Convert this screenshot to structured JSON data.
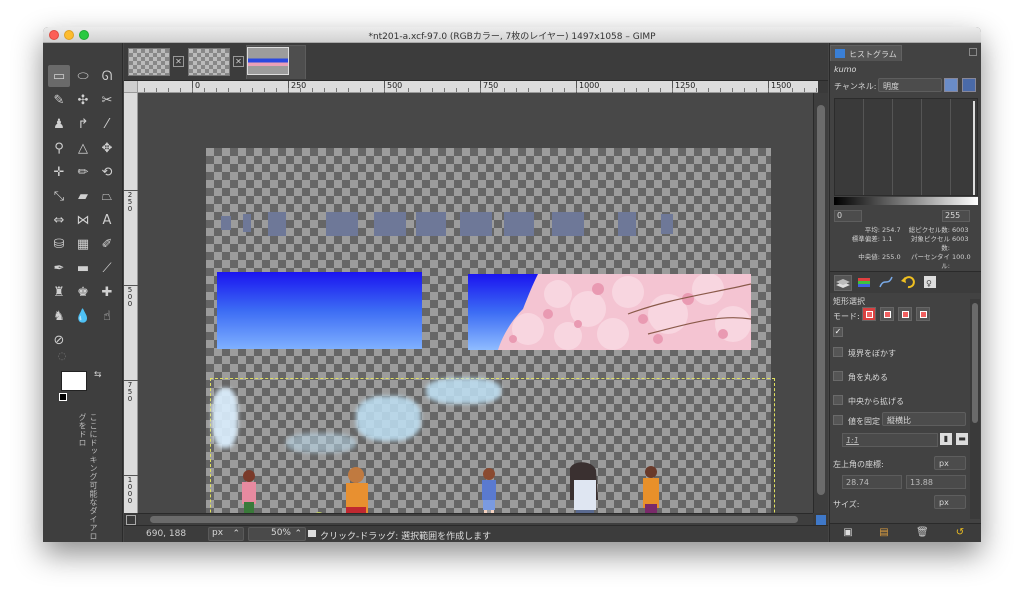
{
  "window": {
    "title": "*nt201-a.xcf-97.0 (RGBカラー, 7枚のレイヤー) 1497x1058 – GIMP"
  },
  "toolbox": {
    "tools": [
      {
        "name": "rect-select-icon",
        "glyph": "▭"
      },
      {
        "name": "ellipse-select-icon",
        "glyph": "⬭"
      },
      {
        "name": "lasso-icon",
        "glyph": "ᘏ"
      },
      {
        "name": "fuzzy-select-icon",
        "glyph": "✎"
      },
      {
        "name": "color-select-icon",
        "glyph": "✣"
      },
      {
        "name": "scissors-icon",
        "glyph": "✂"
      },
      {
        "name": "foreground-select-icon",
        "glyph": "♟"
      },
      {
        "name": "paths-icon",
        "glyph": "↱"
      },
      {
        "name": "color-picker-icon",
        "glyph": "⁄"
      },
      {
        "name": "zoom-icon",
        "glyph": "⚲"
      },
      {
        "name": "measure-icon",
        "glyph": "△"
      },
      {
        "name": "move-icon",
        "glyph": "✥"
      },
      {
        "name": "align-icon",
        "glyph": "✛"
      },
      {
        "name": "crop-icon",
        "glyph": "✏"
      },
      {
        "name": "rotate-icon",
        "glyph": "⟲"
      },
      {
        "name": "scale-icon",
        "glyph": "⤡"
      },
      {
        "name": "shear-icon",
        "glyph": "▰"
      },
      {
        "name": "perspective-icon",
        "glyph": "⏢"
      },
      {
        "name": "flip-icon",
        "glyph": "⇔"
      },
      {
        "name": "cage-icon",
        "glyph": "⋈"
      },
      {
        "name": "text-icon",
        "glyph": "A"
      },
      {
        "name": "bucket-fill-icon",
        "glyph": "⛁"
      },
      {
        "name": "blend-icon",
        "glyph": "▦"
      },
      {
        "name": "pencil-icon",
        "glyph": "✐"
      },
      {
        "name": "paintbrush-icon",
        "glyph": "✒"
      },
      {
        "name": "eraser-icon",
        "glyph": "▬"
      },
      {
        "name": "airbrush-icon",
        "glyph": "⟋"
      },
      {
        "name": "ink-icon",
        "glyph": "♜"
      },
      {
        "name": "clone-icon",
        "glyph": "♚"
      },
      {
        "name": "heal-icon",
        "glyph": "✚"
      },
      {
        "name": "perspective-clone-icon",
        "glyph": "♞"
      },
      {
        "name": "blur-icon",
        "glyph": "💧"
      },
      {
        "name": "smudge-icon",
        "glyph": "☝"
      },
      {
        "name": "dodge-burn-icon",
        "glyph": "⊘"
      }
    ],
    "dock_hint": "ここにドッキング可能なダイアログをドロ"
  },
  "tabs": [
    {
      "label": "layer-thumb-1"
    },
    {
      "label": "layer-thumb-2"
    },
    {
      "label": "layer-thumb-3"
    }
  ],
  "ruler": {
    "labels": [
      "0",
      "250",
      "500",
      "750",
      "1000",
      "1250",
      "1500"
    ],
    "vlabels": [
      "2\n5\n0",
      "5\n0\n0",
      "7\n5\n0",
      "1\n0\n0\n0"
    ]
  },
  "status": {
    "coords": "690, 188",
    "unit": "px",
    "zoom": "50%",
    "message": "クリック-ドラッグ: 選択範囲を作成します"
  },
  "histogram": {
    "tab_label": "ヒストグラム",
    "layer": "kumo",
    "channel_label": "チャンネル:",
    "channel_value": "明度",
    "range_min": "0",
    "range_max": "255",
    "stats": {
      "mean_label": "平均:",
      "mean": "254.7",
      "std_label": "標準偏差:",
      "std": "1.1",
      "median_label": "中央値:",
      "median": "255.0",
      "pixels_label": "総ピクセル数:",
      "pixels": "6003",
      "count_label": "対象ピクセル数:",
      "count": "6003",
      "percentile_label": "パーセンタイル:",
      "percentile": "100.0"
    }
  },
  "tool_options": {
    "title": "矩形選択",
    "mode_label": "モード:",
    "feather": "境界をぼかす",
    "rounded": "角を丸める",
    "expand_center": "中央から拡げる",
    "fixed": "値を固定",
    "fixed_value": "縦横比",
    "ratio": "1:1",
    "position_label": "左上角の座標:",
    "position_unit": "px",
    "pos_x": "28.74",
    "pos_y": "13.88",
    "size_label": "サイズ:",
    "size_unit": "px"
  },
  "colors": {
    "accent": "#3a7fd5",
    "selection": "#e0e060",
    "background": "#454545"
  }
}
